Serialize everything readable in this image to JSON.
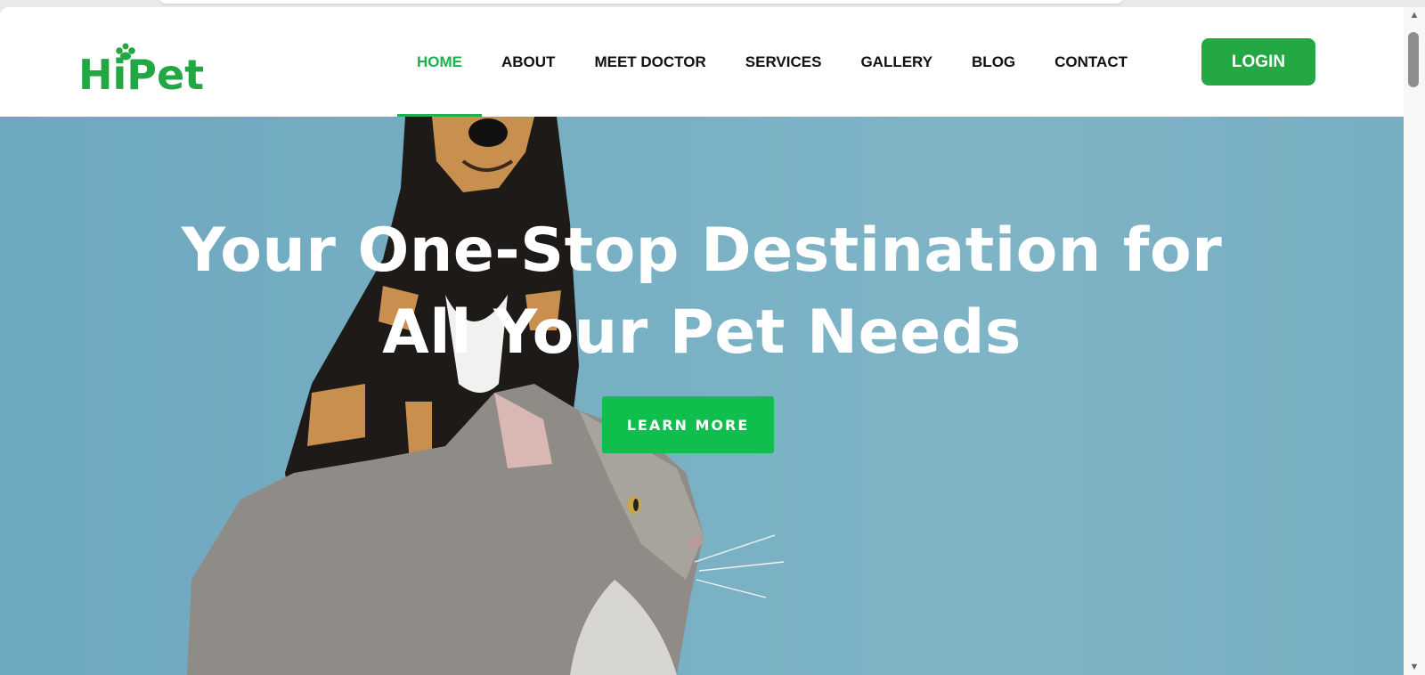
{
  "brand": {
    "logo_text": "HiPet",
    "accent_color": "#1fb04f"
  },
  "nav": {
    "items": [
      {
        "label": "HOME",
        "active": true
      },
      {
        "label": "ABOUT",
        "active": false
      },
      {
        "label": "MEET DOCTOR",
        "active": false
      },
      {
        "label": "SERVICES",
        "active": false
      },
      {
        "label": "GALLERY",
        "active": false
      },
      {
        "label": "BLOG",
        "active": false
      },
      {
        "label": "CONTACT",
        "active": false
      }
    ],
    "login_label": "LOGIN"
  },
  "hero": {
    "title_line1": "Your One-Stop Destination for",
    "title_line2": "All Your Pet Needs",
    "cta_label": "LEARN MORE",
    "background_color": "#77afc3"
  },
  "icons": {
    "logo": "paw-icon",
    "scroll_up": "arrow-up-icon",
    "scroll_down": "arrow-down-icon"
  }
}
